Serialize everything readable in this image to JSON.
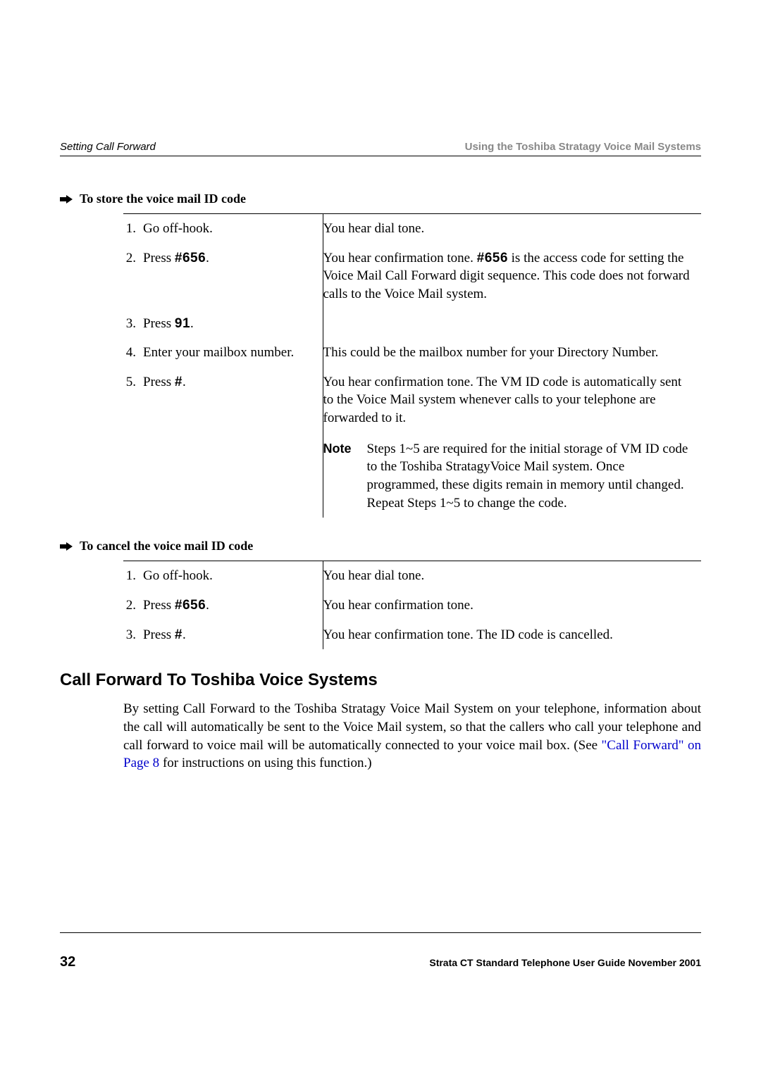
{
  "header": {
    "left": "Setting Call Forward",
    "right": "Using the Toshiba Stratagy Voice Mail Systems"
  },
  "procedure1": {
    "title": "To store the voice mail ID code",
    "steps": [
      {
        "n": "1.",
        "action_pre": "Go off-hook.",
        "code": "",
        "action_post": "",
        "result": "You hear dial tone."
      },
      {
        "n": "2.",
        "action_pre": "Press ",
        "code": "#656",
        "action_post": ".",
        "result_parts": {
          "before": "You hear confirmation tone. ",
          "code": "#656",
          "after": " is the access code for setting the Voice Mail Call Forward digit sequence. This code does not forward calls to the Voice Mail system."
        }
      },
      {
        "n": "3.",
        "action_pre": "Press ",
        "code": "91",
        "action_post": ".",
        "result": ""
      },
      {
        "n": "4.",
        "action_pre": "Enter your mailbox number.",
        "code": "",
        "action_post": "",
        "result": "This could be the mailbox number for your Directory Number."
      },
      {
        "n": "5.",
        "action_pre": "Press ",
        "code": "#",
        "action_post": ".",
        "result": "You hear confirmation tone. The VM ID code is automatically sent to the Voice Mail system whenever calls to your telephone are forwarded to it.",
        "note_label": "Note",
        "note": "Steps 1~5 are required for the initial storage of VM ID code to the Toshiba StratagyVoice Mail system. Once programmed, these digits remain in memory until changed. Repeat Steps 1~5 to change the code."
      }
    ]
  },
  "procedure2": {
    "title": "To cancel the voice mail ID code",
    "steps": [
      {
        "n": "1.",
        "action_pre": "Go off-hook.",
        "code": "",
        "action_post": "",
        "result": "You hear dial tone."
      },
      {
        "n": "2.",
        "action_pre": "Press ",
        "code": "#656",
        "action_post": ".",
        "result": "You hear confirmation tone."
      },
      {
        "n": "3.",
        "action_pre": "Press ",
        "code": "#",
        "action_post": ".",
        "result": "You hear confirmation tone. The ID code is cancelled."
      }
    ]
  },
  "section": {
    "title": "Call Forward To Toshiba Voice Systems",
    "body_before": "By setting Call Forward to the Toshiba Stratagy Voice Mail System on your telephone, information about the call will automatically be sent to the Voice Mail system, so that the callers who call your telephone and call forward to voice mail will be automatically connected to your voice mail box. (See ",
    "link": "\"Call Forward\" on Page 8",
    "body_after": " for instructions on using this function.)"
  },
  "footer": {
    "page": "32",
    "right": "Strata CT Standard Telephone User Guide  November 2001"
  }
}
